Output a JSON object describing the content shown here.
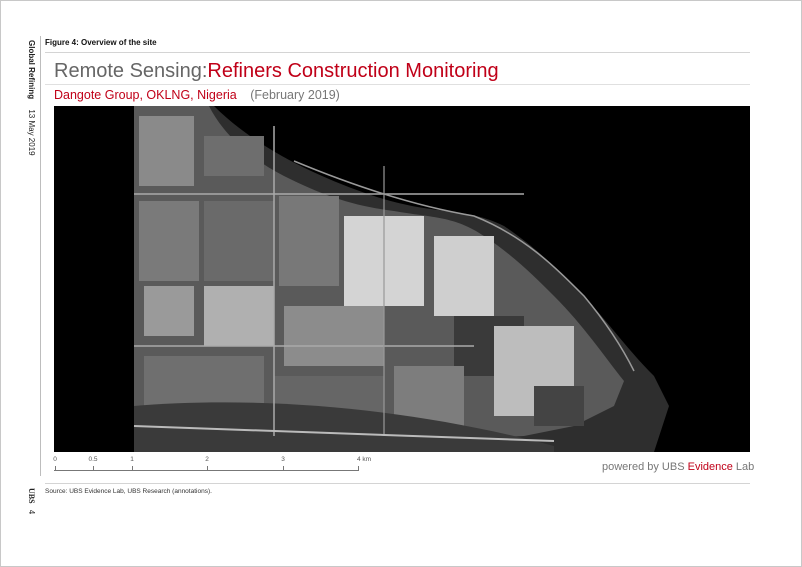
{
  "side": {
    "report_name": "Global Refining",
    "report_date": "13 May 2019",
    "brand": "UBS",
    "page_number": "4"
  },
  "figure": {
    "caption": "Figure 4: Overview of the site",
    "title_prefix": "Remote Sensing:",
    "title_accent": "Refiners Construction Monitoring",
    "location": "Dangote Group, OKLNG, Nigeria",
    "date": "(February 2019)"
  },
  "scale_bar": {
    "labels": [
      "0",
      "0.5",
      "1",
      "2",
      "3",
      "4 km"
    ]
  },
  "credit": {
    "prefix": "powered by UBS ",
    "accent": "Evidence",
    "suffix": " Lab"
  },
  "source": "Source:  UBS Evidence Lab, UBS Research (annotations).",
  "colors": {
    "accent": "#c00018",
    "title_grey": "#666666"
  }
}
